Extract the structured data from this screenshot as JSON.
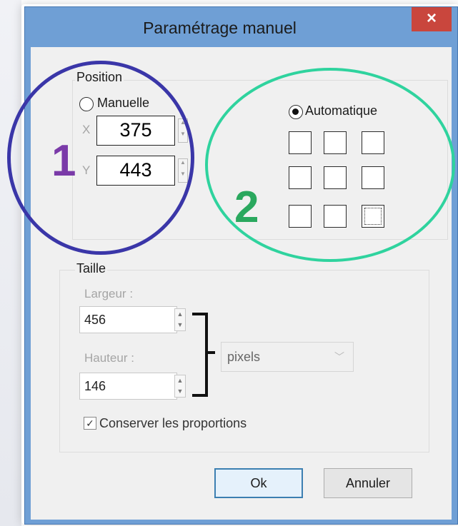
{
  "window": {
    "title": "Paramétrage manuel",
    "close_icon": "close-icon",
    "close_glyph": "×"
  },
  "position": {
    "group_label": "Position",
    "manual_label": "Manuelle",
    "x_label": "X",
    "y_label": "Y",
    "x_value": "375",
    "y_value": "443",
    "automatic_label": "Automatique",
    "automatic_selected": true,
    "anchor_grid_selected": "bottom-right"
  },
  "size": {
    "group_label": "Taille",
    "width_label": "Largeur :",
    "width_value": "456",
    "height_label": "Hauteur :",
    "height_value": "146",
    "unit_value": "pixels",
    "keep_proportions_label": "Conserver les proportions",
    "keep_proportions_checked": true
  },
  "buttons": {
    "ok_label": "Ok",
    "cancel_label": "Annuler"
  },
  "annotations": {
    "label_1": "1",
    "label_2": "2",
    "color_1": "#7a3aa8",
    "color_2": "#2aa85e",
    "circle_1_color": "#3a36a8",
    "circle_2_color": "#2fd39e"
  }
}
